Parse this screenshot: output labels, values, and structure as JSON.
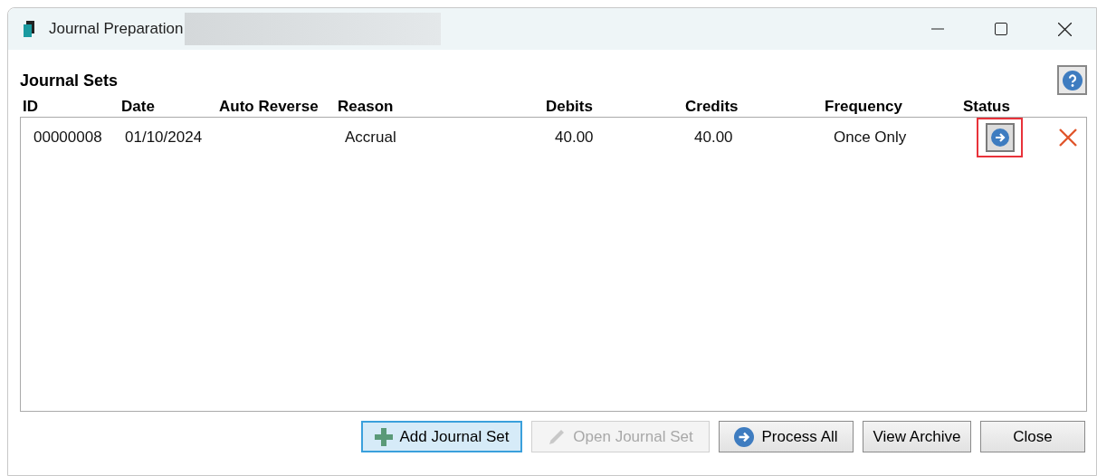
{
  "window": {
    "title": "Journal Preparation"
  },
  "section_title": "Journal Sets",
  "table": {
    "columns": [
      "ID",
      "Date",
      "Auto Reverse",
      "Reason",
      "Debits",
      "Credits",
      "Frequency",
      "Status"
    ],
    "rows": [
      {
        "id": "00000008",
        "date": "01/10/2024",
        "reason": "Accrual",
        "debits": "40.00",
        "credits": "40.00",
        "frequency": "Once Only",
        "status_highlighted": true
      }
    ]
  },
  "buttons": [
    {
      "label": "Add Journal Set",
      "kind": "add",
      "focused": true,
      "disabled": false
    },
    {
      "label": "Open Journal Set",
      "kind": "edit",
      "focused": false,
      "disabled": true
    },
    {
      "label": "Process All",
      "kind": "process",
      "focused": false,
      "disabled": false
    },
    {
      "label": "View Archive",
      "kind": "plain",
      "focused": false,
      "disabled": false
    },
    {
      "label": "Close",
      "kind": "plain",
      "focused": false,
      "disabled": false
    }
  ]
}
